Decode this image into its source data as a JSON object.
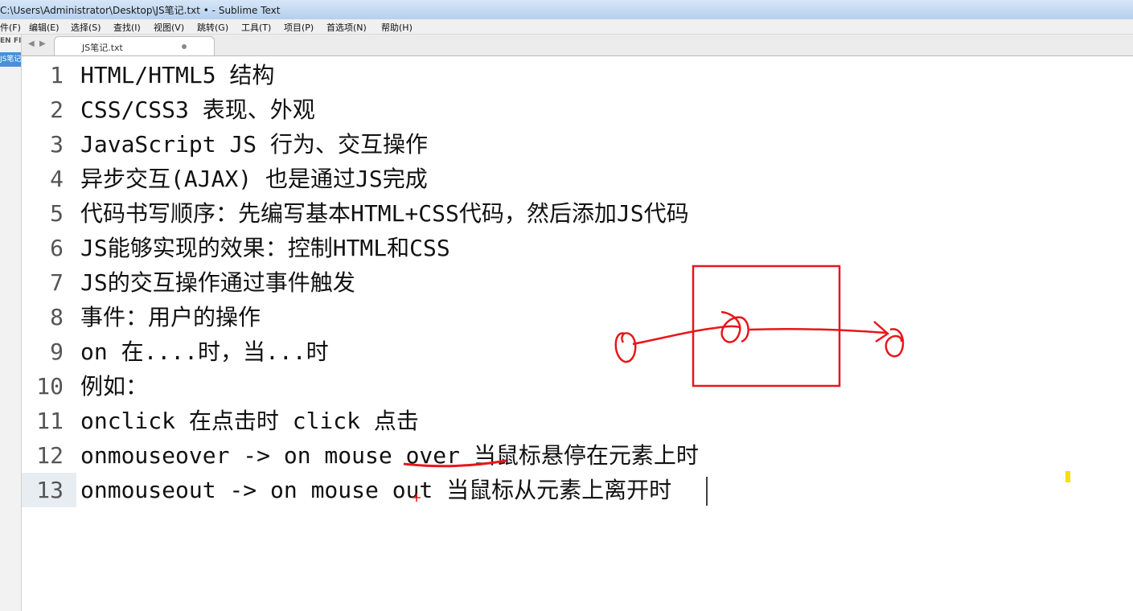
{
  "window": {
    "title": "C:\\Users\\Administrator\\Desktop\\JS笔记.txt • - Sublime Text"
  },
  "menu": [
    "件(F)",
    "编辑(E)",
    "选择(S)",
    "查找(I)",
    "视图(V)",
    "跳转(G)",
    "工具(T)",
    "项目(P)",
    "首选项(N)",
    "帮助(H)"
  ],
  "sidebar": {
    "header": "EN FI",
    "file": "JS笔记"
  },
  "tab": {
    "label": "JS笔记.txt"
  },
  "lines": [
    {
      "n": "1",
      "text": "HTML/HTML5 结构"
    },
    {
      "n": "2",
      "text": "CSS/CSS3 表现、外观"
    },
    {
      "n": "3",
      "text": "JavaScript JS 行为、交互操作"
    },
    {
      "n": "4",
      "text": "异步交互(AJAX) 也是通过JS完成"
    },
    {
      "n": "5",
      "text": "代码书写顺序：先编写基本HTML+CSS代码，然后添加JS代码"
    },
    {
      "n": "6",
      "text": "JS能够实现的效果：控制HTML和CSS"
    },
    {
      "n": "7",
      "text": "JS的交互操作通过事件触发"
    },
    {
      "n": "8",
      "text": "事件：用户的操作"
    },
    {
      "n": "9",
      "text": "on 在....时，当...时"
    },
    {
      "n": "10",
      "text": "例如："
    },
    {
      "n": "11",
      "text": "onclick 在点击时 click 点击"
    },
    {
      "n": "12",
      "text": "onmouseover -> on mouse over 当鼠标悬停在元素上时"
    },
    {
      "n": "13",
      "text": "onmouseout -> on mouse out 当鼠标从元素上离开时"
    }
  ],
  "colors": {
    "annotation": "#e8161b",
    "highlight": "#f5e000"
  }
}
